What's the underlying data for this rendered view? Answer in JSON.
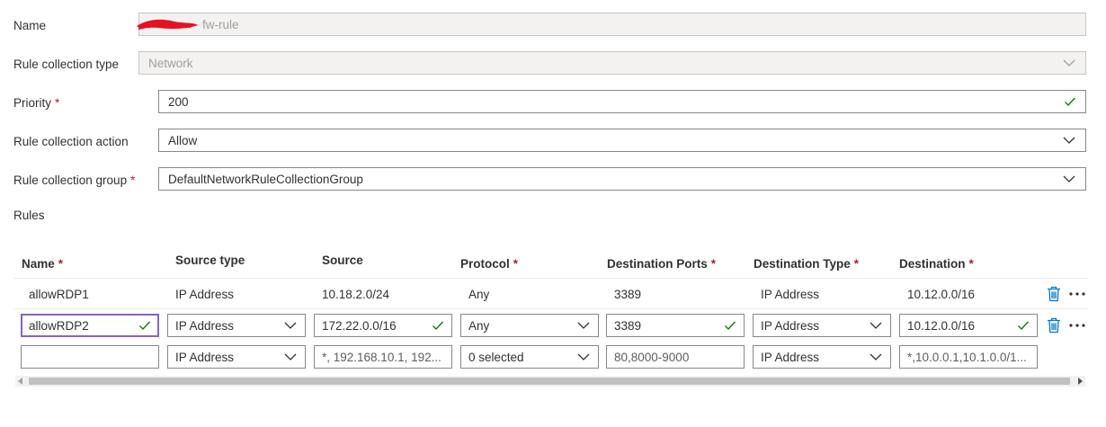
{
  "form": {
    "name": {
      "label": "Name",
      "value": "fw-rule"
    },
    "collection_type": {
      "label": "Rule collection type",
      "value": "Network"
    },
    "priority": {
      "label": "Priority",
      "required": "*",
      "value": "200"
    },
    "action": {
      "label": "Rule collection action",
      "value": "Allow"
    },
    "group": {
      "label": "Rule collection group",
      "required": "*",
      "value": "DefaultNetworkRuleCollectionGroup"
    },
    "rules_label": "Rules"
  },
  "table": {
    "headers": {
      "name": "Name",
      "source_type": "Source type",
      "source": "Source",
      "protocol": "Protocol",
      "dest_ports": "Destination Ports",
      "dest_type": "Destination Type",
      "destination": "Destination",
      "required": "*"
    },
    "rows": [
      {
        "name": "allowRDP1",
        "source_type": "IP Address",
        "source": "10.18.2.0/24",
        "protocol": "Any",
        "dest_ports": "3389",
        "dest_type": "IP Address",
        "destination": "10.12.0.0/16"
      },
      {
        "name": "allowRDP2",
        "source_type": "IP Address",
        "source": "172.22.0.0/16",
        "protocol": "Any",
        "dest_ports": "3389",
        "dest_type": "IP Address",
        "destination": "10.12.0.0/16"
      }
    ],
    "new_row": {
      "name": "",
      "source_type": "IP Address",
      "source_placeholder": "*, 192.168.10.1, 192...",
      "protocol": "0 selected",
      "dest_ports_placeholder": "80,8000-9000",
      "dest_type": "IP Address",
      "destination_placeholder": "*,10.0.0.1,10.1.0.0/1..."
    }
  },
  "colors": {
    "accent": "#0078d4",
    "valid": "#107c10",
    "required": "#a4262c",
    "focus": "#8764b8",
    "redaction": "#e81123"
  }
}
